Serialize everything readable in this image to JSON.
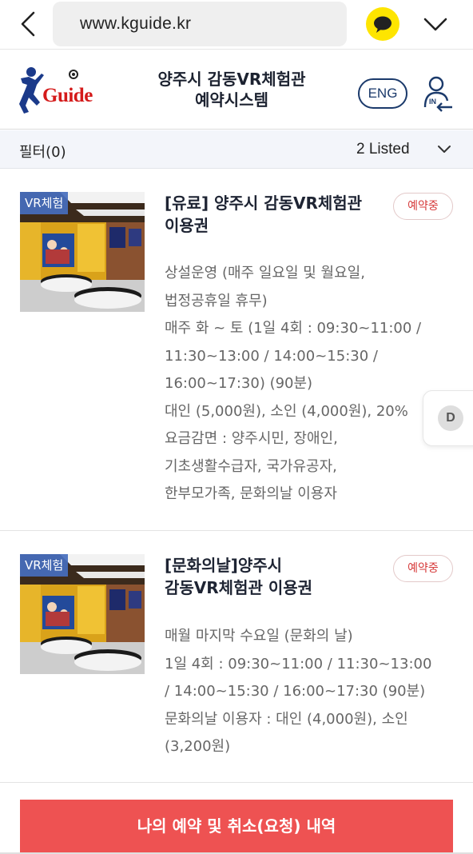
{
  "browser": {
    "url": "www.kguide.kr",
    "back_icon": "chevron-left-icon",
    "talk_icon": "speech-bubble-icon",
    "menu_icon": "chevron-down-icon"
  },
  "header": {
    "logo_text": "Guide",
    "title_line1": "양주시 감동VR체험관",
    "title_line2": "예약시스템",
    "lang_button": "ENG",
    "login_icon_label": "IN"
  },
  "filter": {
    "label": "필터(0)",
    "listed": "2 Listed"
  },
  "listings": [
    {
      "badge": "VR체험",
      "title_line1": "[유료] 양주시 감동VR체험관",
      "title_line2": "이용권",
      "status": "예약중",
      "lines": [
        "상설운영 (매주 일요일 및 월요일,",
        "법정공휴일 휴무)",
        "매주 화 ~ 토 (1일 4회 : 09:30~11:00 /",
        "11:30~13:00 / 14:00~15:30 /",
        "16:00~17:30) (90분)",
        "대인 (5,000원), 소인 (4,000원), 20%",
        "요금감면 : 양주시민, 장애인,",
        "기초생활수급자, 국가유공자,",
        "한부모가족, 문화의날 이용자"
      ]
    },
    {
      "badge": "VR체험",
      "title_line1": "[문화의날]양주시",
      "title_line2": "감동VR체험관 이용권",
      "status": "예약중",
      "lines": [
        "매월 마지막 수요일 (문화의 날)",
        "1일 4회 : 09:30~11:00 / 11:30~13:00",
        "/ 14:00~15:30 / 16:00~17:30 (90분)",
        "문화의날 이용자 : 대인 (4,000원), 소인",
        "(3,200원)"
      ]
    }
  ],
  "side_tab": {
    "label": "D"
  },
  "cta": {
    "label": "나의 예약 및 취소(요청) 내역"
  },
  "colors": {
    "accent_red": "#ee5252",
    "status_red": "#d63a3a",
    "brand_navy": "#1b3a6b",
    "kakao_yellow": "#fee500"
  }
}
